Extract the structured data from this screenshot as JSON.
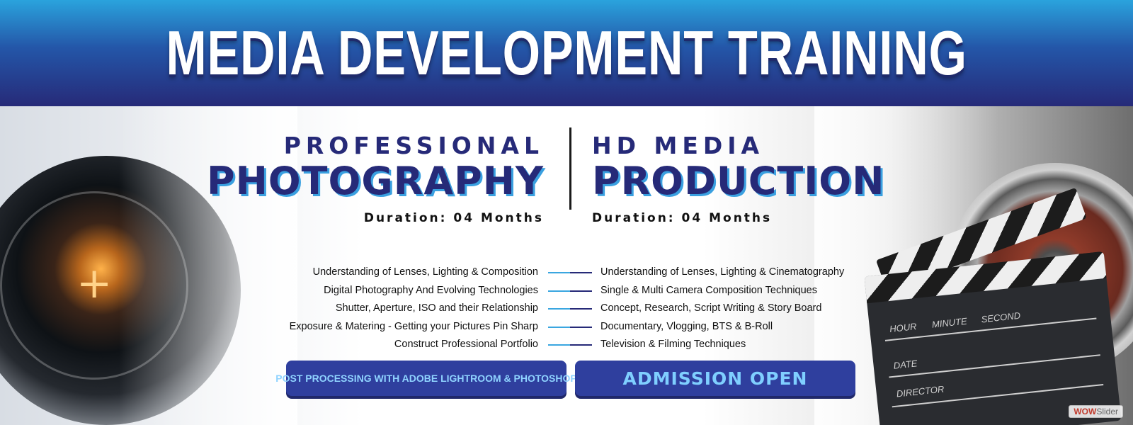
{
  "header": {
    "title": "MEDIA DEVELOPMENT TRAINING"
  },
  "programs": {
    "left": {
      "subtitle": "PROFESSIONAL",
      "title": "PHOTOGRAPHY",
      "duration": "Duration: 04 Months"
    },
    "right": {
      "subtitle": "HD MEDIA",
      "title": "PRODUCTION",
      "duration": "Duration: 04 Months"
    }
  },
  "curriculum": {
    "left": [
      "Understanding of Lenses, Lighting & Composition",
      "Digital Photography And Evolving Technologies",
      "Shutter, Aperture, ISO and their Relationship",
      "Exposure & Matering - Getting your Pictures Pin Sharp",
      "Construct Professional Portfolio"
    ],
    "right": [
      "Understanding of Lenses, Lighting & Cinematography",
      "Single & Multi Camera Composition Techniques",
      "Concept, Research, Script Writing & Story Board",
      "Documentary, Vlogging, BTS & B-Roll",
      "Television & Filming Techniques"
    ]
  },
  "buttons": {
    "post_processing": "POST PROCESSING WITH ADOBE LIGHTROOM & PHOTOSHOP",
    "admission": "ADMISSION OPEN"
  },
  "clapperboard": {
    "hour": "HOUR",
    "minute": "MINUTE",
    "second": "SECOND",
    "date": "DATE",
    "director": "DIRECTOR"
  },
  "watermark": {
    "part1": "WOW",
    "part2": "Slider"
  },
  "colors": {
    "navy": "#262a78",
    "accent_blue": "#3aa6e0",
    "header_top": "#2aa3dd",
    "button": "#2f3f9e"
  }
}
